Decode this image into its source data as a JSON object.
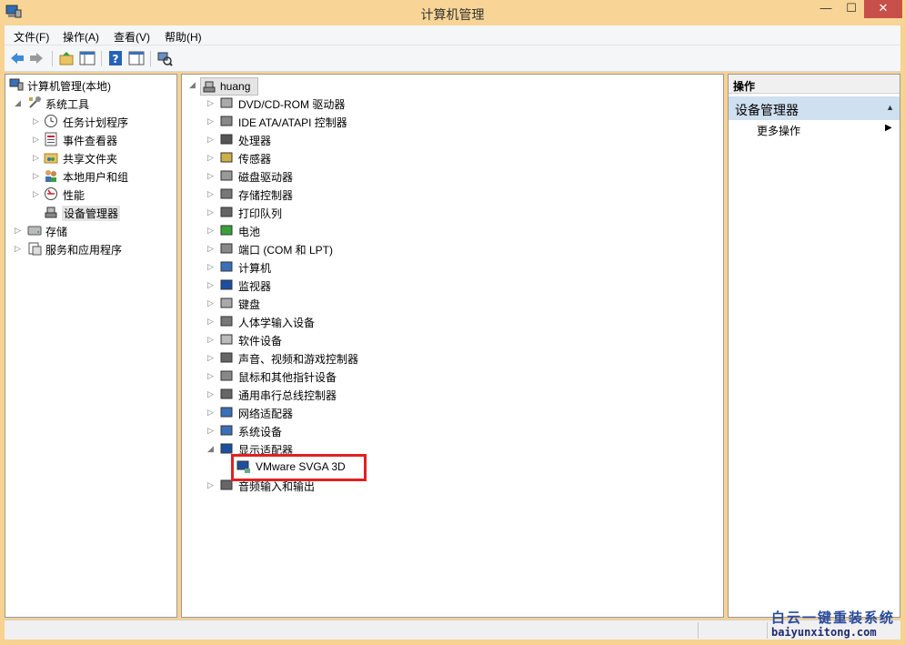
{
  "window": {
    "title": "计算机管理",
    "min_glyph": "—",
    "max_glyph": "☐",
    "close_glyph": "✕"
  },
  "menu": [
    "文件(F)",
    "操作(A)",
    "查看(V)",
    "帮助(H)"
  ],
  "toolbar_icons": [
    "back-arrow-icon",
    "forward-arrow-icon",
    "up-folder-icon",
    "show-hide-tree-icon",
    "help-icon",
    "properties-icon",
    "scan-hardware-icon"
  ],
  "left_tree": {
    "root": "计算机管理(本地)",
    "system_tools": "系统工具",
    "children": [
      "任务计划程序",
      "事件查看器",
      "共享文件夹",
      "本地用户和组",
      "性能",
      "设备管理器"
    ],
    "storage": "存储",
    "services": "服务和应用程序"
  },
  "device_tree": {
    "host": "huang",
    "categories": [
      "DVD/CD-ROM 驱动器",
      "IDE ATA/ATAPI 控制器",
      "处理器",
      "传感器",
      "磁盘驱动器",
      "存储控制器",
      "打印队列",
      "电池",
      "端口 (COM 和 LPT)",
      "计算机",
      "监视器",
      "键盘",
      "人体学输入设备",
      "软件设备",
      "声音、视频和游戏控制器",
      "鼠标和其他指针设备",
      "通用串行总线控制器",
      "网络适配器",
      "系统设备",
      "显示适配器",
      "音频输入和输出"
    ],
    "display_adapter_child": "VMware SVGA 3D"
  },
  "actions": {
    "header": "操作",
    "section": "设备管理器",
    "more": "更多操作"
  },
  "watermark": {
    "brand": "白云一键重装系统",
    "url": "baiyunxitong.com"
  },
  "colors": {
    "titlebar": "#f8d596",
    "close_button": "#c7504a",
    "highlight_box": "#e22020",
    "action_section": "#cfe0f1"
  }
}
